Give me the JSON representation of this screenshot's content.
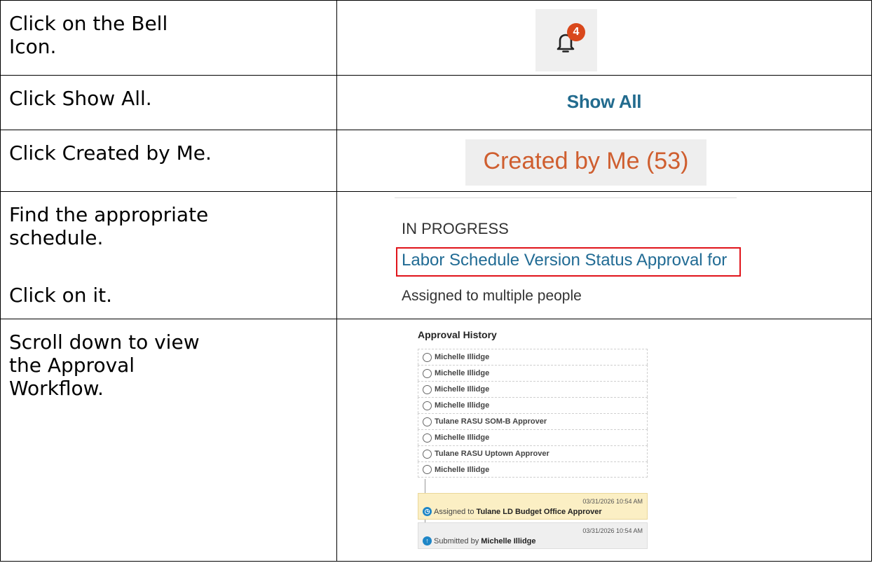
{
  "steps": [
    {
      "instruction": "Click on the Bell Icon.",
      "instruction_lines": [
        "Click on the Bell",
        "Icon."
      ]
    },
    {
      "instruction": "Click Show All."
    },
    {
      "instruction": "Click Created by Me."
    },
    {
      "instruction_lines": [
        "Find the appropriate",
        "schedule."
      ],
      "instruction_extra": "Click on it."
    },
    {
      "instruction_lines": [
        "Scroll down to view",
        "the Approval",
        "Workflow."
      ]
    }
  ],
  "bell": {
    "icon": "bell-icon",
    "badge_count": "4",
    "badge_color": "#d9481c"
  },
  "show_all": {
    "label": "Show All",
    "color": "#226b8e"
  },
  "created_by_me": {
    "label": "Created by Me (53)",
    "color": "#cf5e2f"
  },
  "task_list": {
    "section_heading": "IN PROGRESS",
    "task_title": "Labor Schedule Version Status Approval for",
    "assignment": "Assigned to multiple people",
    "highlight_color": "#e0141b"
  },
  "approval_history": {
    "title": "Approval History",
    "approvers": [
      "Michelle Illidge",
      "Michelle Illidge",
      "Michelle Illidge",
      "Michelle Illidge",
      "Tulane RASU SOM-B Approver",
      "Michelle Illidge",
      "Tulane RASU Uptown Approver",
      "Michelle Illidge"
    ],
    "assigned_card": {
      "timestamp": "03/31/2026 10:54 AM",
      "prefix": "Assigned to",
      "name": "Tulane LD Budget Office Approver"
    },
    "submitted_card": {
      "timestamp": "03/31/2026 10:54 AM",
      "prefix": "Submitted by",
      "name": "Michelle Illidge"
    }
  }
}
